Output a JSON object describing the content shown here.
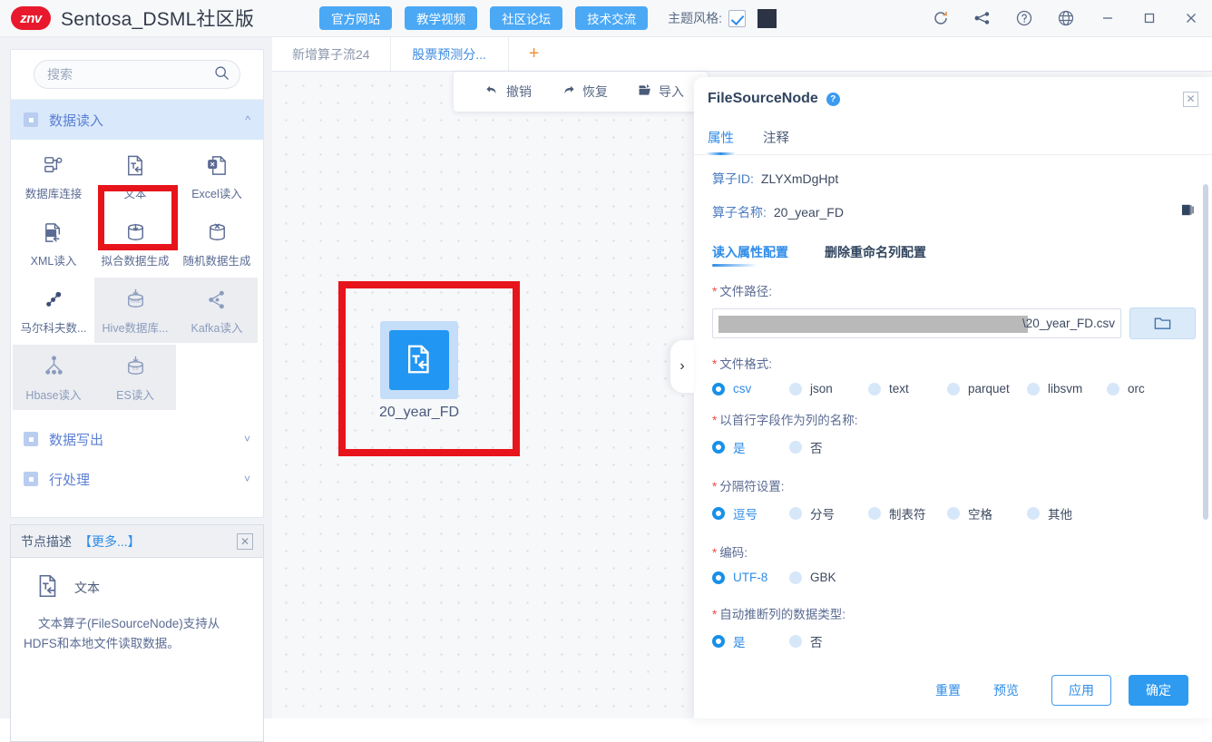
{
  "titlebar": {
    "logo_text": "znv",
    "app_title": "Sentosa_DSML社区版",
    "buttons": [
      {
        "label": "官方网站"
      },
      {
        "label": "教学视频"
      },
      {
        "label": "社区论坛"
      },
      {
        "label": "技术交流"
      }
    ],
    "theme_label": "主题风格:",
    "theme_checked": true,
    "theme_color": "#2b3345",
    "window_icons": [
      "refresh-icon",
      "flow-icon",
      "help-icon",
      "globe-icon",
      "minimize-icon",
      "maximize-icon",
      "close-icon"
    ]
  },
  "sidebar": {
    "search": {
      "value": "",
      "placeholder": "搜索"
    },
    "categories": [
      {
        "label": "数据读入",
        "expanded": true,
        "active": true
      },
      {
        "label": "数据写出",
        "expanded": false,
        "active": false
      },
      {
        "label": "行处理",
        "expanded": false,
        "active": false
      }
    ],
    "operators": [
      {
        "label": "数据库连接",
        "icon": "database-connect-icon",
        "disabled": false
      },
      {
        "label": "文本",
        "icon": "text-file-icon",
        "disabled": false,
        "highlighted": true
      },
      {
        "label": "Excel读入",
        "icon": "excel-file-icon",
        "disabled": false
      },
      {
        "label": "XML读入",
        "icon": "xml-file-icon",
        "disabled": false
      },
      {
        "label": "拟合数据生成",
        "icon": "fit-data-icon",
        "disabled": false
      },
      {
        "label": "随机数据生成",
        "icon": "random-data-icon",
        "disabled": false
      },
      {
        "label": "马尔科夫数...",
        "icon": "markov-icon",
        "disabled": false
      },
      {
        "label": "Hive数据库...",
        "icon": "hive-icon",
        "disabled": true
      },
      {
        "label": "Kafka读入",
        "icon": "kafka-icon",
        "disabled": true
      },
      {
        "label": "Hbase读入",
        "icon": "hbase-icon",
        "disabled": true
      },
      {
        "label": "ES读入",
        "icon": "es-icon",
        "disabled": true
      }
    ],
    "node_desc": {
      "title": "节点描述",
      "more": "【更多...】",
      "name": "文本",
      "icon": "text-file-icon",
      "text": "文本算子(FileSourceNode)支持从HDFS和本地文件读取数据。"
    }
  },
  "canvas": {
    "tabs": [
      {
        "label": "新增算子流24",
        "active": false
      },
      {
        "label": "股票预测分...",
        "active": true
      }
    ],
    "add_tab": "+",
    "toolbar": [
      {
        "label": "撤销",
        "icon": "undo-icon"
      },
      {
        "label": "恢复",
        "icon": "redo-icon"
      },
      {
        "label": "导入",
        "icon": "import-icon"
      }
    ],
    "node": {
      "label": "20_year_FD",
      "icon": "text-file-icon"
    }
  },
  "panel": {
    "title": "FileSourceNode",
    "help_icon": "question-icon",
    "close_icon": "close-icon",
    "tabs": [
      {
        "label": "属性",
        "active": true
      },
      {
        "label": "注释",
        "active": false
      }
    ],
    "operator_id_label": "算子ID:",
    "operator_id_value": "ZLYXmDgHpt",
    "operator_name_label": "算子名称:",
    "operator_name_value": "20_year_FD",
    "copy_icon": "copy-icon",
    "subtabs": [
      {
        "label": "读入属性配置",
        "active": true
      },
      {
        "label": "删除重命名列配置",
        "active": false
      }
    ],
    "fields": [
      {
        "label": "文件路径:",
        "required": true,
        "type": "path",
        "value": "\\20_year_FD.csv",
        "browse_icon": "folder-icon"
      },
      {
        "label": "文件格式:",
        "required": true,
        "type": "radio",
        "options": [
          "csv",
          "json",
          "text",
          "parquet",
          "libsvm",
          "orc"
        ],
        "selected": "csv"
      },
      {
        "label": "以首行字段作为列的名称:",
        "required": true,
        "type": "radio",
        "options": [
          "是",
          "否"
        ],
        "selected": "是"
      },
      {
        "label": "分隔符设置:",
        "required": true,
        "type": "radio",
        "options": [
          "逗号",
          "分号",
          "制表符",
          "空格",
          "其他"
        ],
        "selected": "逗号"
      },
      {
        "label": "编码:",
        "required": true,
        "type": "radio",
        "options": [
          "UTF-8",
          "GBK"
        ],
        "selected": "UTF-8"
      },
      {
        "label": "自动推断列的数据类型:",
        "required": true,
        "type": "radio",
        "options": [
          "是",
          "否"
        ],
        "selected": "是"
      }
    ],
    "footer": {
      "reset": "重置",
      "preview": "预览",
      "apply": "应用",
      "ok": "确定"
    }
  },
  "colors": {
    "accent": "#2e8ce8",
    "header_button": "#4aa8f5",
    "highlight_box": "#e8141b",
    "node_blue": "#2196f3"
  }
}
